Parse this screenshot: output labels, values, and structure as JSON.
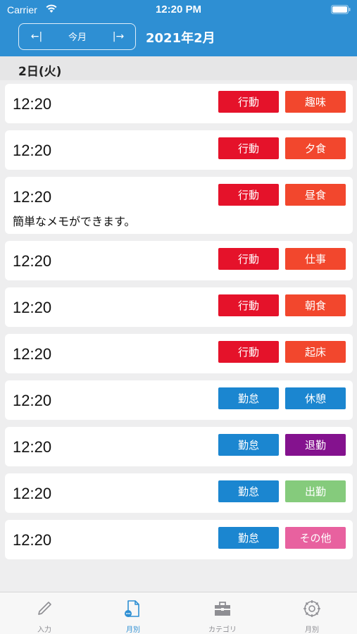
{
  "status_bar": {
    "carrier": "Carrier",
    "time": "12:20 PM"
  },
  "header": {
    "prev_label": "←|",
    "current_label": "今月",
    "next_label": "|→",
    "title": "2021年2月"
  },
  "section": {
    "label": "2日(火)"
  },
  "entries": [
    {
      "time": "12:20",
      "memo": "",
      "tags": [
        {
          "label": "行動",
          "color": "#e5122a"
        },
        {
          "label": "趣味",
          "color": "#f2472d"
        }
      ]
    },
    {
      "time": "12:20",
      "memo": "",
      "tags": [
        {
          "label": "行動",
          "color": "#e5122a"
        },
        {
          "label": "夕食",
          "color": "#f2472d"
        }
      ]
    },
    {
      "time": "12:20",
      "memo": "簡単なメモができます。",
      "tags": [
        {
          "label": "行動",
          "color": "#e5122a"
        },
        {
          "label": "昼食",
          "color": "#f2472d"
        }
      ]
    },
    {
      "time": "12:20",
      "memo": "",
      "tags": [
        {
          "label": "行動",
          "color": "#e5122a"
        },
        {
          "label": "仕事",
          "color": "#f2472d"
        }
      ]
    },
    {
      "time": "12:20",
      "memo": "",
      "tags": [
        {
          "label": "行動",
          "color": "#e5122a"
        },
        {
          "label": "朝食",
          "color": "#f2472d"
        }
      ]
    },
    {
      "time": "12:20",
      "memo": "",
      "tags": [
        {
          "label": "行動",
          "color": "#e5122a"
        },
        {
          "label": "起床",
          "color": "#f2472d"
        }
      ]
    },
    {
      "time": "12:20",
      "memo": "",
      "tags": [
        {
          "label": "勤怠",
          "color": "#1b86d0"
        },
        {
          "label": "休憩",
          "color": "#1b86d0"
        }
      ]
    },
    {
      "time": "12:20",
      "memo": "",
      "tags": [
        {
          "label": "勤怠",
          "color": "#1b86d0"
        },
        {
          "label": "退勤",
          "color": "#84128e"
        }
      ]
    },
    {
      "time": "12:20",
      "memo": "",
      "tags": [
        {
          "label": "勤怠",
          "color": "#1b86d0"
        },
        {
          "label": "出勤",
          "color": "#85cb7c"
        }
      ]
    },
    {
      "time": "12:20",
      "memo": "",
      "tags": [
        {
          "label": "勤怠",
          "color": "#1b86d0"
        },
        {
          "label": "その他",
          "color": "#e8619f"
        }
      ]
    }
  ],
  "tabbar": {
    "active_color": "#2e8fd3",
    "items": [
      {
        "label": "入力",
        "icon": "pencil-icon"
      },
      {
        "label": "月別",
        "icon": "document-icon"
      },
      {
        "label": "カテゴリ",
        "icon": "toolbox-icon"
      },
      {
        "label": "月別",
        "icon": "gear-icon"
      }
    ]
  }
}
